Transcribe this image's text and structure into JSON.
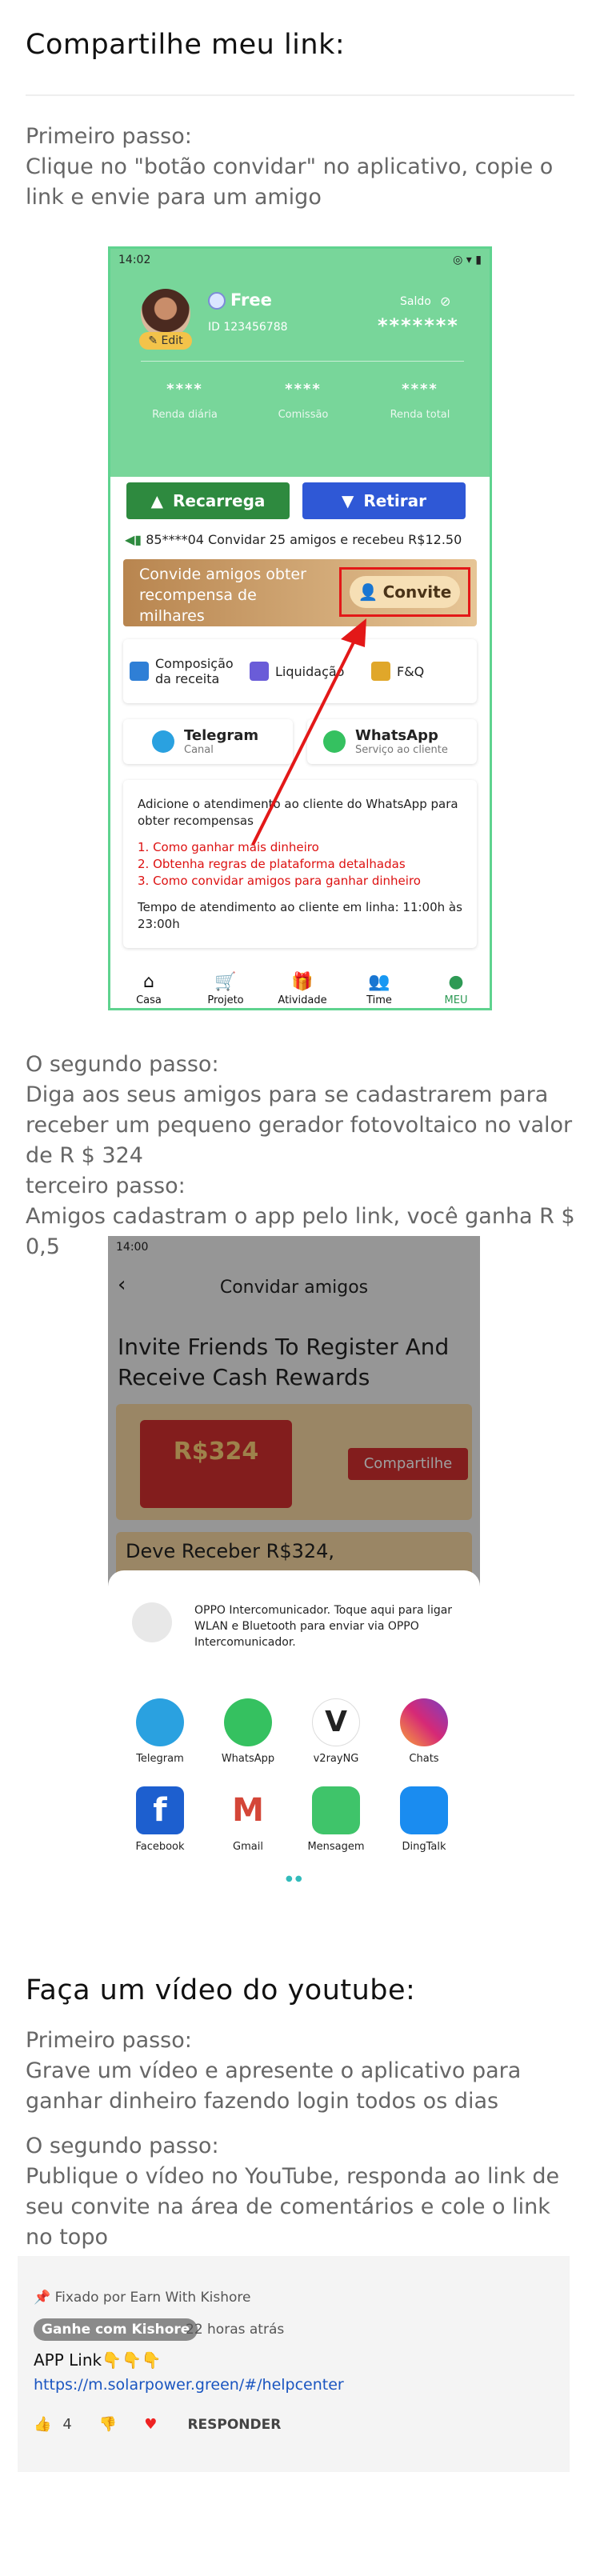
{
  "section1": {
    "title": "Compartilhe meu link:",
    "step1_label": "Primeiro passo:",
    "step1_text": "Clique no \"botão convidar\" no aplicativo, copie o link e envie para um amigo",
    "step2_label": "O segundo passo:",
    "step2_text": "Diga aos seus amigos para se cadastrarem para receber um pequeno gerador fotovoltaico no valor de R $ 324",
    "step3_label": "terceiro passo:",
    "step3_text": "Amigos cadastram o app pelo link, você ganha R $ 0,5"
  },
  "phone1": {
    "time": "14:02",
    "status_icons": "◎ ▾ ▮",
    "edit": "✎ Edit",
    "plan": "Free",
    "user_id": "ID 123456788",
    "saldo": "Saldo",
    "saldo_value": "*******",
    "stats": [
      {
        "value": "****",
        "label": "Renda diária"
      },
      {
        "value": "****",
        "label": "Comissão"
      },
      {
        "value": "****",
        "label": "Renda total"
      }
    ],
    "recarrega": "Recarrega",
    "retirar": "Retirar",
    "notice": "85****04 Convidar 25 amigos e recebeu R$12.50",
    "banner_text": "Convide amigos obter recompensa de milhares",
    "convite": "Convite",
    "menu": [
      "Composição da receita",
      "Liquidação",
      "F&Q"
    ],
    "telegram": "Telegram",
    "telegram_sub": "Canal",
    "whatsapp": "WhatsApp",
    "whatsapp_sub": "Serviço ao cliente",
    "wa_intro": "Adicione o atendimento ao cliente do WhatsApp para obter recompensas",
    "wa_items": [
      "1. Como ganhar mais dinheiro",
      "2. Obtenha regras de plataforma detalhadas",
      "3. Como convidar amigos para ganhar dinheiro"
    ],
    "wa_hours": "Tempo de atendimento ao cliente em linha: 11:00h às 23:00h",
    "tabs": [
      "Casa",
      "Projeto",
      "Atividade",
      "Time",
      "MEU"
    ]
  },
  "phone2": {
    "time": "14:00",
    "title": "Convidar amigos",
    "headline": "Invite Friends To Register And Receive Cash Rewards",
    "amount": "R$324",
    "share_button": "Compartilhe",
    "deve": "Deve Receber R$324,",
    "oppo_text": "OPPO Intercomunicador. Toque aqui para ligar WLAN e Bluetooth para enviar via OPPO Intercomunicador.",
    "apps_row1": [
      "Telegram",
      "WhatsApp",
      "v2rayNG",
      "Chats"
    ],
    "apps_row2": [
      "Facebook",
      "Gmail",
      "Mensagem",
      "DingTalk"
    ]
  },
  "section2": {
    "title": "Faça um vídeo do youtube:",
    "step1_label": "Primeiro passo:",
    "step1_text": "Grave um vídeo e apresente o aplicativo para ganhar dinheiro fazendo login todos os dias",
    "step2_label": "O segundo passo:",
    "step2_text": "Publique o vídeo no YouTube, responda ao link de seu convite na área de comentários e cole o link no topo"
  },
  "youtube_comment": {
    "pinned": "Fixado por Earn With Kishore",
    "author": "Ganhe com Kishore",
    "time": "22 horas atrás",
    "text": "APP Link👇👇👇",
    "link": "https://m.solarpower.green/#/helpcenter",
    "likes": "4",
    "reply": "RESPONDER"
  },
  "colors": {
    "green": "#78d69a",
    "red": "#e31818",
    "blue": "#2f58d6"
  }
}
